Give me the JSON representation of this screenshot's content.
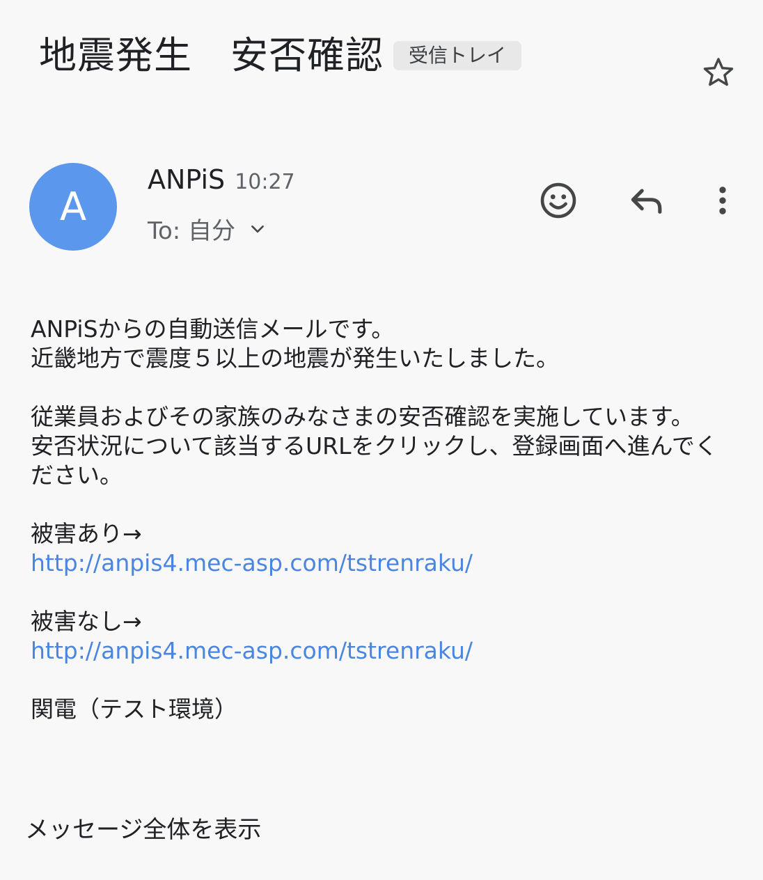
{
  "email": {
    "subject": "地震発生　安否確認",
    "label": "受信トレイ",
    "sender": {
      "avatar_letter": "A",
      "name": "ANPiS",
      "time": "10:27",
      "to": "To: 自分"
    },
    "body": {
      "line1": "ANPiSからの自動送信メールです。",
      "line2": "近畿地方で震度５以上の地震が発生いたしました。",
      "line3": "従業員およびその家族のみなさまの安否確認を実施しています。",
      "line4": "安否状況について該当するURLをクリックし、登録画面へ進んでください。",
      "damage_yes_label": "被害あり→",
      "damage_yes_link": "http://anpis4.mec-asp.com/tstrenraku/",
      "damage_no_label": "被害なし→",
      "damage_no_link": "http://anpis4.mec-asp.com/tstrenraku/",
      "signature": "関電（テスト環境）"
    },
    "show_full_message": "メッセージ全体を表示"
  },
  "icons": {
    "star": "star-icon",
    "emoji": "emoji-icon",
    "reply": "reply-icon",
    "more": "more-vert-icon",
    "chevron": "chevron-down-icon"
  },
  "colors": {
    "avatar": "#5c97ee",
    "link": "#4a86e0",
    "chip": "#e8e8e9",
    "background": "#f8f8f9"
  }
}
